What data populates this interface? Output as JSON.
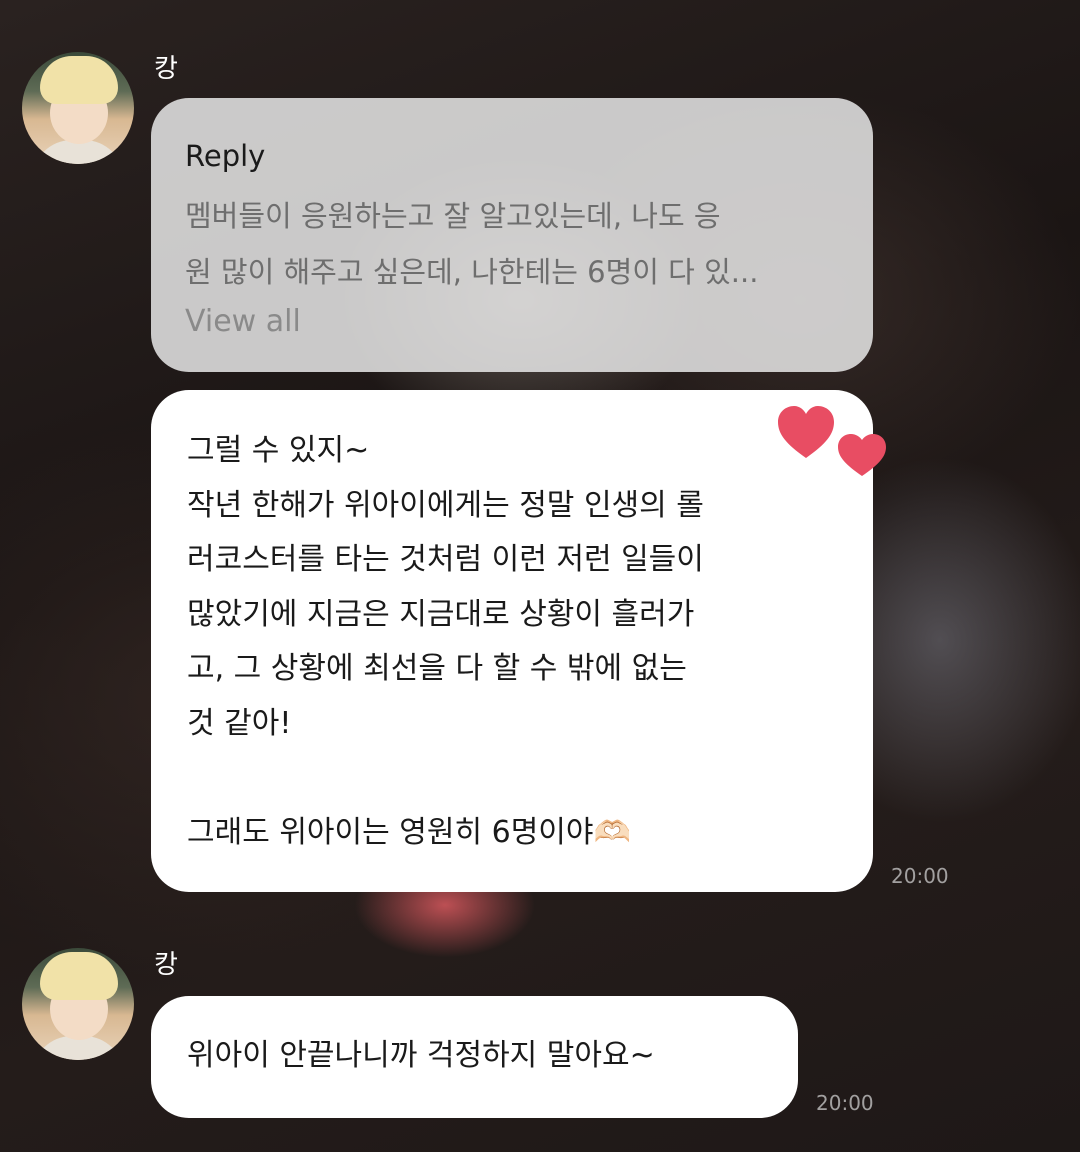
{
  "messages": [
    {
      "sender": "캉",
      "reply": {
        "label": "Reply",
        "text": "멤버들이 응원하는고 잘 알고있는데, 나도 응\n원 많이 해주고 싶은데, 나한테는 6명이 다 있...",
        "view_all": "View all"
      },
      "body": "그럴 수 있지~\n작년 한해가 위아이에게는 정말 인생의 롤\n러코스터를 타는 것처럼 이런 저런 일들이\n많았기에 지금은 지금대로 상황이 흘러가\n고, 그 상황에 최선을 다 할 수 밖에 없는\n것 같아!\n\n그래도 위아이는 영원히 6명이야🫶🏻",
      "time": "20:00"
    },
    {
      "sender": "캉",
      "body": "위아이 안끝나니까 걱정하지 말아요~",
      "time": "20:00"
    }
  ],
  "icons": {
    "hearts": "hearts-icon",
    "avatar": "profile-avatar"
  },
  "colors": {
    "heart": "#e84d63",
    "bubble": "#ffffff",
    "reply_bubble": "#e6e6e6"
  }
}
